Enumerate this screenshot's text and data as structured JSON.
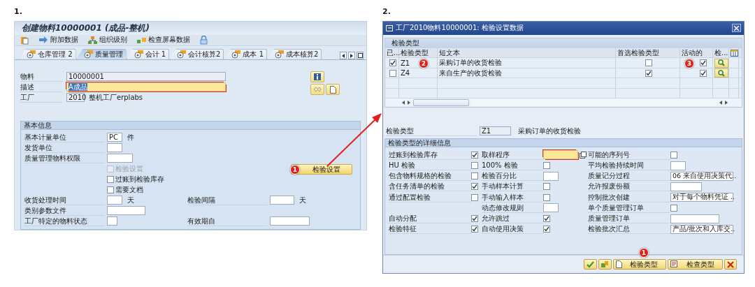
{
  "left": {
    "step": "1.",
    "title": "创建物料10000001 (成品-整机)",
    "toolbar": [
      {
        "kind": "icon"
      },
      {
        "kind": "button",
        "label": "附加数据"
      },
      {
        "kind": "button",
        "label": "组织级别"
      },
      {
        "kind": "button",
        "label": "检查屏幕数据"
      },
      {
        "kind": "icon"
      }
    ],
    "tabs": [
      {
        "label": "仓库管理 2",
        "selected": false
      },
      {
        "label": "质量管理",
        "selected": true
      },
      {
        "label": "会计 1",
        "selected": false
      },
      {
        "label": "会计核算2",
        "selected": false
      },
      {
        "label": "成本 1",
        "selected": false
      },
      {
        "label": "成本核算2",
        "selected": false
      }
    ],
    "header_fields": [
      {
        "label": "物料",
        "value": "10000001",
        "editable": false,
        "focused": false
      },
      {
        "label": "描述",
        "value": "A成品",
        "editable": true,
        "focused": true
      },
      {
        "label": "工厂",
        "value": "2010",
        "editable": false,
        "focused": false,
        "description": "整机工厂erplabs"
      }
    ],
    "group": {
      "title": "基本信息",
      "fields": [
        {
          "label": "基本计量单位",
          "value": "PC",
          "unit": "件"
        },
        {
          "label": "发货单位"
        },
        {
          "label": "质量管理物料权限"
        }
      ],
      "checkboxes": [
        {
          "label": "检验设置",
          "checked": false,
          "disabled": true
        },
        {
          "label": "过账到检验库存",
          "checked": false,
          "disabled": false
        },
        {
          "label": "需要文档",
          "checked": false,
          "disabled": false
        }
      ],
      "button": {
        "label": "检验设置",
        "badge": "1"
      },
      "bottom_rows": [
        {
          "cells": [
            {
              "label": "收货处理时间",
              "unit": "天"
            },
            {
              "label": "检验间隔",
              "unit": "天"
            }
          ]
        },
        {
          "cells": [
            {
              "label": "类别参数文件"
            }
          ]
        },
        {
          "cells": [
            {
              "label": "工厂特定的物料状态"
            },
            {
              "label": "有效期自"
            }
          ]
        }
      ]
    }
  },
  "right": {
    "step": "2.",
    "title": "工厂2010物料10000001: 检验设置数据",
    "table": {
      "title": "检验类型",
      "columns": [
        "已...",
        "检验类型",
        "短文本",
        "首选检验类型",
        "活动的",
        "检..."
      ],
      "rows": [
        {
          "checked": true,
          "type": "Z1",
          "text": "采购订单的收货检验",
          "preferred": false,
          "active": true,
          "type_badge": "2",
          "active_badge": "3"
        },
        {
          "checked": false,
          "type": "Z4",
          "text": "来自生产的收货检验",
          "preferred": true,
          "active": true
        }
      ]
    },
    "current": {
      "label": "检验类型",
      "value": "Z1",
      "description": "采购订单的收货检验"
    },
    "details": {
      "title": "检验类型的详细信息",
      "rows": [
        [
          {
            "kind": "checkbox",
            "label": "过账到检验库存",
            "checked": true
          },
          {
            "kind": "lookup",
            "label": "取样程序",
            "focused": true
          },
          {
            "kind": "checkbox",
            "label": "可能的序列号",
            "checked": false
          }
        ],
        [
          {
            "kind": "checkbox",
            "label": "HU 检验",
            "checked": false
          },
          {
            "kind": "checkbox",
            "label": "100% 检验",
            "checked": false
          },
          {
            "kind": "input",
            "label": "平均检验持续时间"
          }
        ],
        [
          {
            "kind": "checkbox",
            "label": "包含物料规格的检验",
            "checked": false
          },
          {
            "kind": "input",
            "label": "检验百分比"
          },
          {
            "kind": "select",
            "label": "质量记分过程",
            "value": "06 来自使用决策代.."
          }
        ],
        [
          {
            "kind": "checkbox",
            "label": "含任务清单的检验",
            "checked": true
          },
          {
            "kind": "checkbox",
            "label": "手动样本计算",
            "checked": false
          },
          {
            "kind": "input",
            "label": "允许报废份额"
          }
        ],
        [
          {
            "kind": "checkbox",
            "label": "通过配置检验",
            "checked": false
          },
          {
            "kind": "checkbox",
            "label": "手动输入样本",
            "checked": false
          },
          {
            "kind": "select",
            "label": "控制批次创建",
            "value": "对于每个物料凭证 .."
          }
        ],
        [
          {
            "kind": "spacer"
          },
          {
            "kind": "input",
            "label": "动态修改规则"
          },
          {
            "kind": "checkbox",
            "label": "单个质量管理订单",
            "checked": false
          }
        ],
        [
          {
            "kind": "checkbox",
            "label": "自动分配",
            "checked": true
          },
          {
            "kind": "checkbox",
            "label": "允许跳过",
            "checked": true
          },
          {
            "kind": "input",
            "label": "质量管理订单"
          }
        ],
        [
          {
            "kind": "checkbox",
            "label": "检验特征",
            "checked": true
          },
          {
            "kind": "checkbox",
            "label": "自动使用决策",
            "checked": true
          },
          {
            "kind": "select",
            "label": "检验批次汇总",
            "value": "产品/批次和入库交.."
          }
        ]
      ]
    },
    "footer": {
      "buttons": [
        {
          "kind": "icon"
        },
        {
          "kind": "icon"
        },
        {
          "kind": "button",
          "label": "检验类型",
          "badge": "1"
        },
        {
          "kind": "button",
          "label": "检查类型"
        },
        {
          "kind": "icon"
        }
      ]
    }
  }
}
